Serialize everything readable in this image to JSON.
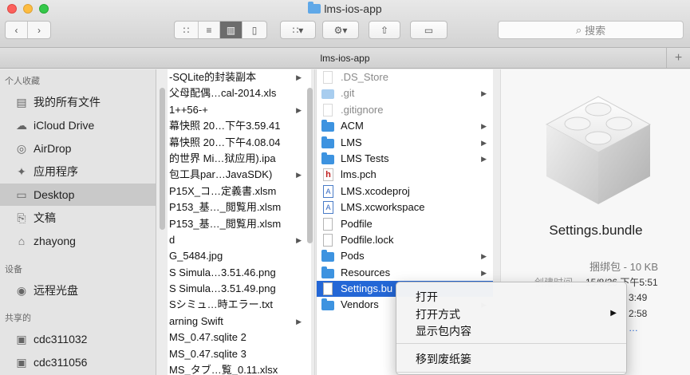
{
  "window": {
    "title": "lms-ios-app"
  },
  "toolbar": {
    "back_icon": "chevron-left-icon",
    "forward_icon": "chevron-right-icon",
    "search_placeholder": "搜索"
  },
  "pathbar": {
    "title": "lms-ios-app",
    "add_label": "+"
  },
  "sidebar": {
    "favorites_heading": "个人收藏",
    "favorites": [
      {
        "label": "我的所有文件",
        "icon": "all-files-icon"
      },
      {
        "label": "iCloud Drive",
        "icon": "cloud-icon"
      },
      {
        "label": "AirDrop",
        "icon": "airdrop-icon"
      },
      {
        "label": "应用程序",
        "icon": "applications-icon"
      },
      {
        "label": "Desktop",
        "icon": "desktop-icon",
        "selected": true
      },
      {
        "label": "文稿",
        "icon": "documents-icon"
      },
      {
        "label": "zhayong",
        "icon": "home-icon"
      }
    ],
    "devices_heading": "设备",
    "devices": [
      {
        "label": "远程光盘",
        "icon": "disc-icon"
      }
    ],
    "shared_heading": "共享的",
    "shared": [
      {
        "label": "cdc311032",
        "icon": "computer-icon"
      },
      {
        "label": "cdc311056",
        "icon": "computer-icon"
      }
    ]
  },
  "column1": [
    {
      "name": "-SQLite的封装副本",
      "arrow": true
    },
    {
      "name": "父母配偶…cal-2014.xls",
      "arrow": false
    },
    {
      "name": "1++56-+",
      "arrow": true
    },
    {
      "name": "幕快照 20…下午3.59.41",
      "arrow": false
    },
    {
      "name": "幕快照 20…下午4.08.04",
      "arrow": false
    },
    {
      "name": "的世界 Mi…狱应用).ipa",
      "arrow": false
    },
    {
      "name": "包工具par…JavaSDK)",
      "arrow": true
    },
    {
      "name": "P15X_コ…定義書.xlsm",
      "arrow": false
    },
    {
      "name": "P153_基…_閲覧用.xlsm",
      "arrow": false
    },
    {
      "name": "P153_基…_閲覧用.xlsm",
      "arrow": false
    },
    {
      "name": "d",
      "arrow": true
    },
    {
      "name": "G_5484.jpg",
      "arrow": false
    },
    {
      "name": "S Simula…3.51.46.png",
      "arrow": false
    },
    {
      "name": "S Simula…3.51.49.png",
      "arrow": false
    },
    {
      "name": "Sシミュ…時エラー.txt",
      "arrow": false
    },
    {
      "name": "arning Swift",
      "arrow": true
    },
    {
      "name": "MS_0.47.sqlite 2",
      "arrow": false
    },
    {
      "name": "MS_0.47.sqlite 3",
      "arrow": false
    },
    {
      "name": "MS_タブ…覧_0.11.xlsx",
      "arrow": false
    }
  ],
  "column2": [
    {
      "name": ".DS_Store",
      "type": "doc-faded",
      "arrow": false,
      "faded": true
    },
    {
      "name": ".git",
      "type": "folder-faded",
      "arrow": true,
      "faded": true
    },
    {
      "name": ".gitignore",
      "type": "doc-faded",
      "arrow": false,
      "faded": true
    },
    {
      "name": "ACM",
      "type": "folder",
      "arrow": true
    },
    {
      "name": "LMS",
      "type": "folder",
      "arrow": true
    },
    {
      "name": "LMS Tests",
      "type": "folder",
      "arrow": true
    },
    {
      "name": "lms.pch",
      "type": "hfile",
      "arrow": false
    },
    {
      "name": "LMS.xcodeproj",
      "type": "xc",
      "arrow": false
    },
    {
      "name": "LMS.xcworkspace",
      "type": "xc",
      "arrow": false
    },
    {
      "name": "Podfile",
      "type": "doc",
      "arrow": false
    },
    {
      "name": "Podfile.lock",
      "type": "doc",
      "arrow": false
    },
    {
      "name": "Pods",
      "type": "folder",
      "arrow": true
    },
    {
      "name": "Resources",
      "type": "folder",
      "arrow": true
    },
    {
      "name": "Settings.bu",
      "type": "bundle",
      "arrow": false,
      "selected": true
    },
    {
      "name": "Vendors",
      "type": "folder",
      "arrow": true
    }
  ],
  "preview": {
    "name": "Settings.bundle",
    "kind": "捆绑包 - 10 KB",
    "created_label": "创建时间",
    "created_value": "15/8/26 下午5:51",
    "partial_1": "3:49",
    "partial_2": "2:58",
    "partial_3": "…"
  },
  "context_menu": {
    "items": [
      "打开",
      "打开方式",
      "显示包内容",
      "移到废纸篓"
    ],
    "submenu_arrow": "▶"
  },
  "colors": {
    "selection": "#2467d6",
    "folder": "#3d93e0"
  }
}
